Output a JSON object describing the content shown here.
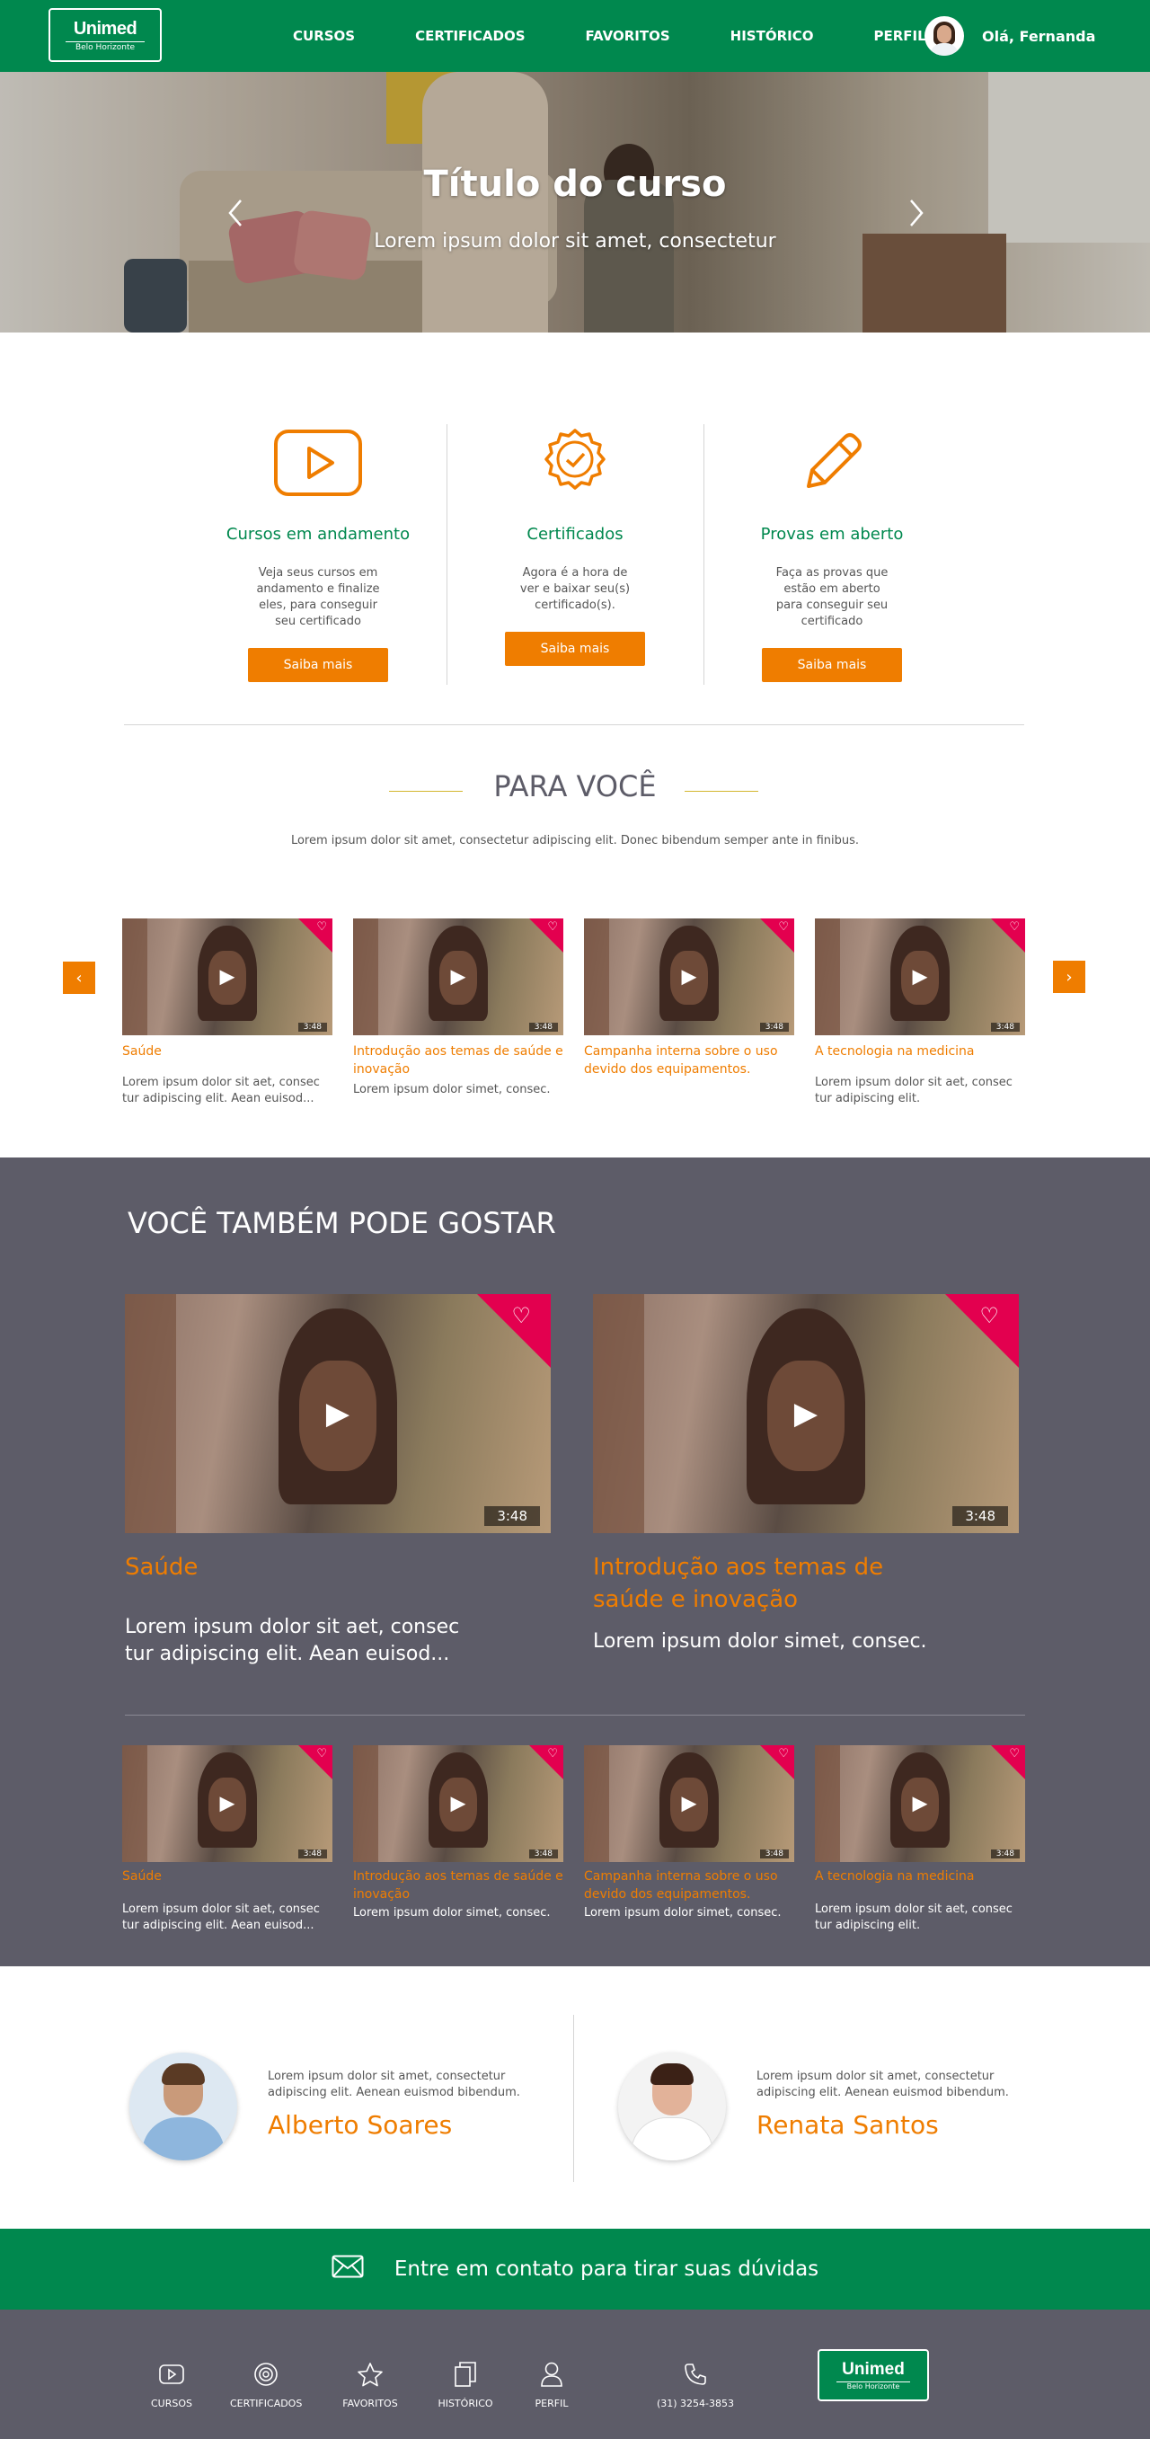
{
  "header": {
    "logo_word": "Unimed",
    "logo_sub": "Belo Horizonte",
    "nav": [
      "CURSOS",
      "CERTIFICADOS",
      "FAVORITOS",
      "HISTÓRICO",
      "PERFIL"
    ],
    "greeting": "Olá, Fernanda"
  },
  "hero": {
    "title": "Título do curso",
    "subtitle": "Lorem ipsum dolor sit amet, consectetur"
  },
  "features": [
    {
      "icon": "play-icon",
      "title": "Cursos em andamento",
      "text": "Veja seus cursos em andamento e finalize eles, para conseguir seu certificado",
      "button": "Saiba mais"
    },
    {
      "icon": "certificate-badge-icon",
      "title": "Certificados",
      "text": "Agora é a hora de ver e baixar seu(s) certificado(s).",
      "button": "Saiba mais"
    },
    {
      "icon": "pencil-icon",
      "title": "Provas em aberto",
      "text": "Faça as provas que estão em aberto para conseguir seu certificado",
      "button": "Saiba mais"
    }
  ],
  "para_voce": {
    "title": "PARA VOCÊ",
    "description": "Lorem ipsum dolor sit amet, consectetur adipiscing elit. Donec bibendum semper ante in finibus.",
    "cards": [
      {
        "title": "Saúde",
        "text": "Lorem ipsum dolor sit aet, consec tur adipiscing elit. Aean euisod...",
        "duration": "3:48"
      },
      {
        "title": "Introdução aos temas de saúde e inovação",
        "text": "Lorem ipsum dolor simet, consec.",
        "duration": "3:48"
      },
      {
        "title": "Campanha interna sobre o uso devido dos equipamentos.",
        "text": "",
        "duration": "3:48"
      },
      {
        "title": "A tecnologia na medicina",
        "text": "Lorem ipsum dolor sit aet, consec tur adipiscing elit.",
        "duration": "3:48"
      }
    ]
  },
  "gostar": {
    "title": "VOCÊ TAMBÉM PODE GOSTAR",
    "big_cards": [
      {
        "title": "Saúde",
        "text": "Lorem ipsum dolor sit aet, consec tur adipiscing elit. Aean euisod...",
        "duration": "3:48"
      },
      {
        "title": "Introdução aos temas de saúde e inovação",
        "text": "Lorem ipsum dolor simet, consec.",
        "duration": "3:48"
      }
    ],
    "small_cards": [
      {
        "title": "Saúde",
        "text": "Lorem ipsum dolor sit aet, consec tur adipiscing elit. Aean euisod...",
        "duration": "3:48"
      },
      {
        "title": "Introdução aos temas de saúde e inovação",
        "text": "Lorem ipsum dolor simet, consec.",
        "duration": "3:48"
      },
      {
        "title": "Campanha interna sobre o uso devido dos equipamentos.",
        "text": "Lorem ipsum dolor simet, consec.",
        "duration": "3:48"
      },
      {
        "title": "A tecnologia na medicina",
        "text": "Lorem ipsum dolor sit aet, consec tur adipiscing elit.",
        "duration": "3:48"
      }
    ]
  },
  "testimonials": [
    {
      "name": "Alberto Soares",
      "text": "Lorem ipsum dolor sit amet, consectetur adipiscing elit. Aenean euismod bibendum."
    },
    {
      "name": "Renata Santos",
      "text": "Lorem ipsum dolor sit amet, consectetur adipiscing elit. Aenean euismod bibendum."
    }
  ],
  "contact": {
    "text": "Entre em contato para tirar suas dúvidas"
  },
  "footer": {
    "items": [
      {
        "icon": "play-icon",
        "label": "CURSOS"
      },
      {
        "icon": "certificate-icon",
        "label": "CERTIFICADOS"
      },
      {
        "icon": "star-icon",
        "label": "FAVORITOS"
      },
      {
        "icon": "history-icon",
        "label": "HISTÓRICO"
      },
      {
        "icon": "user-icon",
        "label": "PERFIL"
      },
      {
        "icon": "phone-icon",
        "label": "(31) 3254-3853"
      }
    ],
    "logo_word": "Unimed",
    "logo_sub": "Belo Horizonte"
  },
  "colors": {
    "green": "#00884e",
    "orange": "#ef7d00",
    "gray": "#5d5c68",
    "pink": "#e3004f"
  }
}
